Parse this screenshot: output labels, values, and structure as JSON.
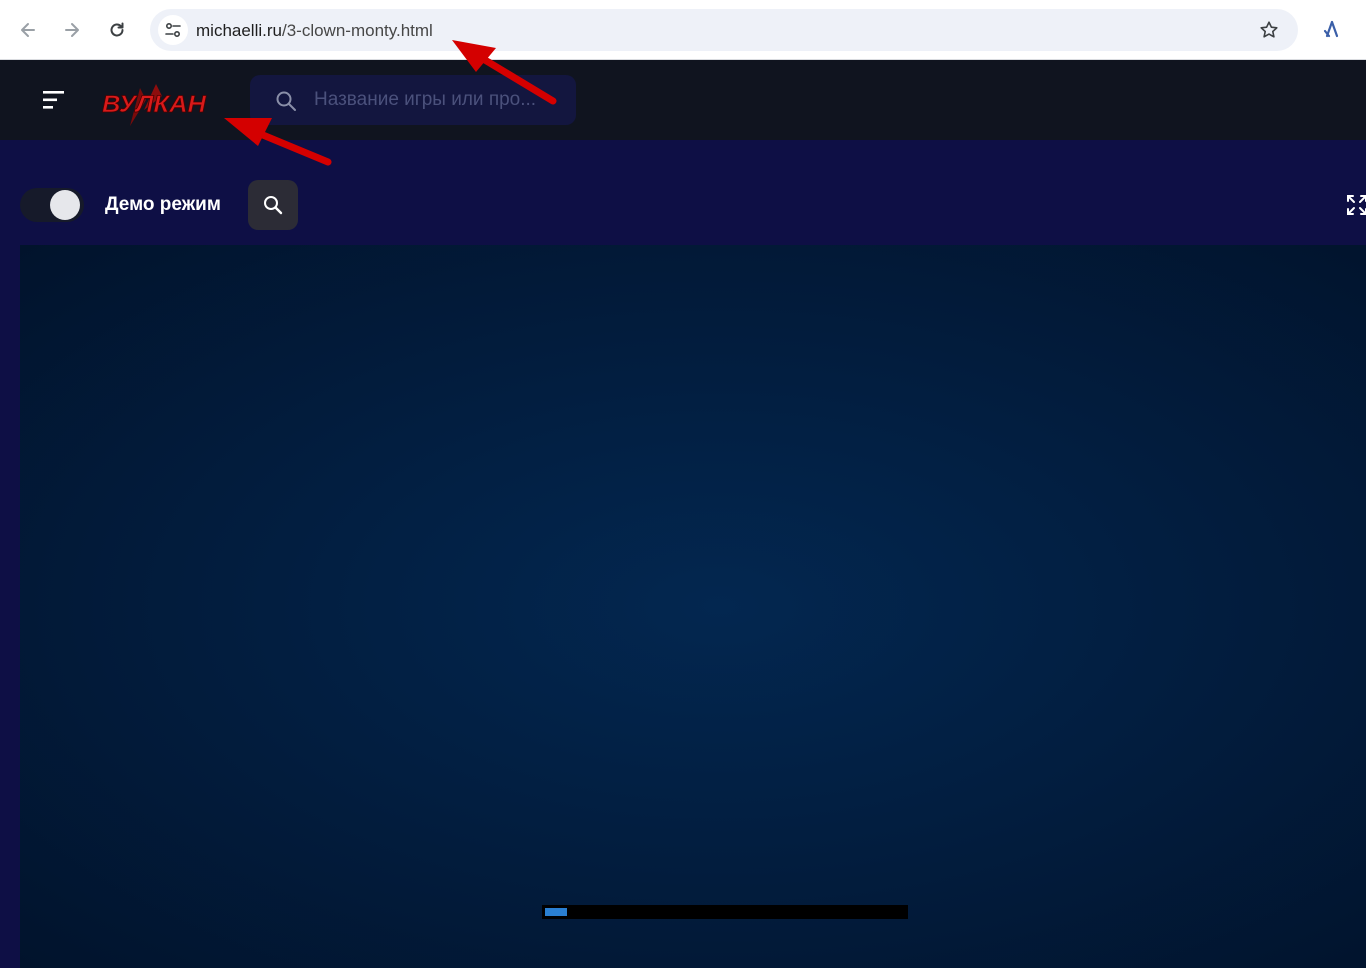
{
  "browser": {
    "url_domain": "michaelli.ru",
    "url_path": "/3-clown-monty.html"
  },
  "site": {
    "logo_text": "ВУЛКАН",
    "search": {
      "placeholder": "Название игры или про...",
      "value": ""
    }
  },
  "game_bar": {
    "demo_label": "Демо режим",
    "demo_mode_on": true
  },
  "loader": {
    "progress": 0.06
  },
  "colors": {
    "page_bg": "#0e0f45",
    "header_bg": "#10141f",
    "logo_red": "#d81a1a",
    "arrow_red": "#d40000",
    "loader_fill": "#2a7fd1"
  },
  "icons": {
    "back": "arrow-left-icon",
    "forward": "arrow-right-icon",
    "reload": "reload-icon",
    "site_info": "tune-icon",
    "bookmark": "star-icon",
    "extension": "extension-icon",
    "menu": "menu-icon",
    "search": "search-icon",
    "zoom": "magnifier-icon",
    "fullscreen": "fullscreen-icon"
  }
}
